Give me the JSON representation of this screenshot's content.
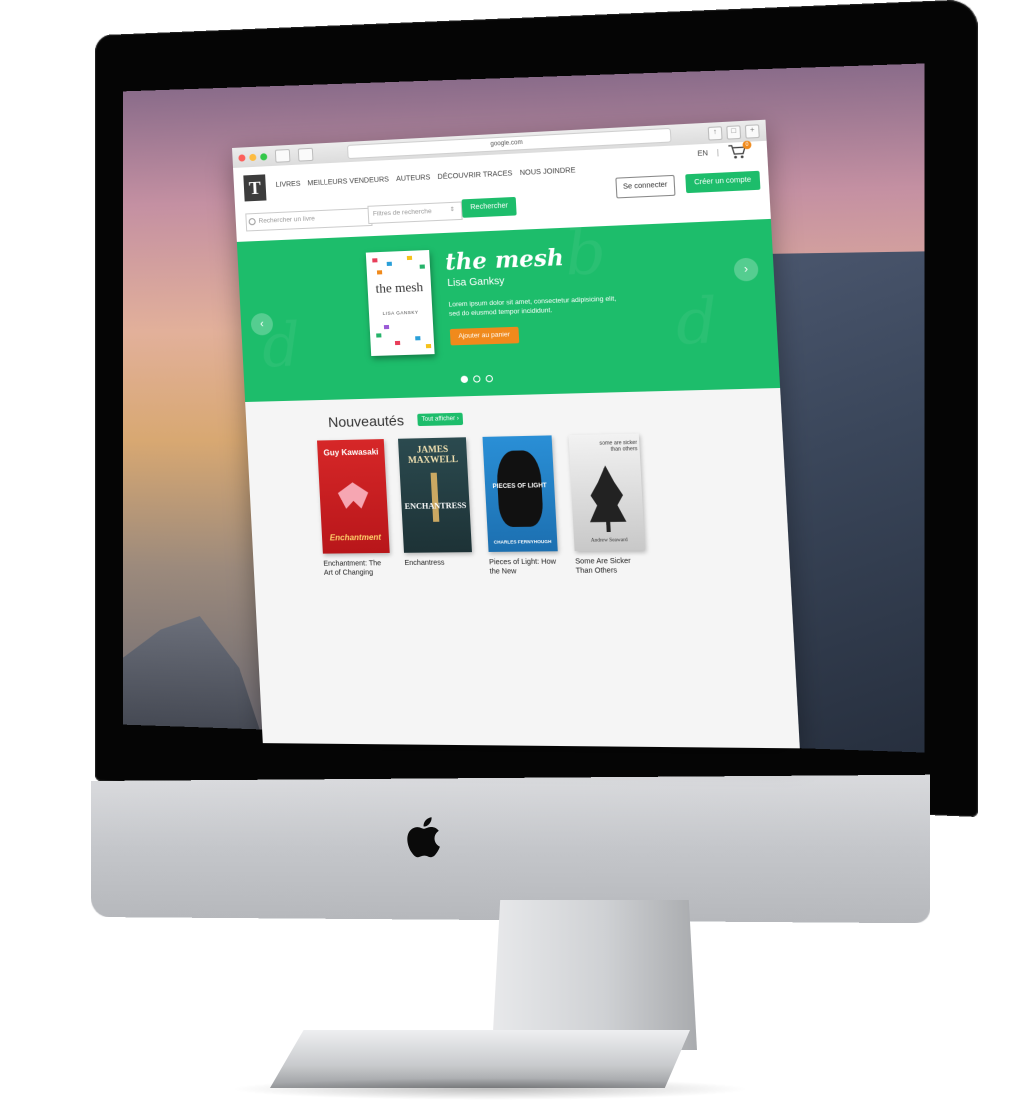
{
  "browser": {
    "address": "google.com"
  },
  "site": {
    "logo": "T",
    "nav": [
      "LIVRES",
      "MEILLEURS VENDEURS",
      "AUTEURS",
      "DÉCOUVRIR TRACES",
      "NOUS JOINDRE"
    ],
    "lang": "EN",
    "lang_sep": "|",
    "cart_count": "0",
    "login_label": "Se connecter",
    "signup_label": "Créer un compte",
    "search_placeholder": "Rechercher un livre",
    "filter_placeholder": "Filtres de recherche",
    "search_label": "Rechercher"
  },
  "hero": {
    "cover_title": "the mesh",
    "cover_author": "LISA GANSKY",
    "title": "the mesh",
    "author": "Lisa Ganksy",
    "description": "Lorem ipsum dolor sit amet, consectetur adipisicing elit, sed do eiusmod tempor incididunt.",
    "add_to_cart_label": "Ajouter au panier",
    "prev_icon": "chevron-left-icon",
    "next_icon": "chevron-right-icon",
    "slides": 3,
    "active_slide": 1
  },
  "new_releases": {
    "title": "Nouveautés",
    "show_all_label": "Tout afficher ›",
    "books": [
      {
        "title": "Enchantment: The Art of Changing",
        "cover_top": "Guy Kawasaki",
        "cover_bottom": "Enchantment"
      },
      {
        "title": "Enchantress",
        "cover_top": "JAMES MAXWELL",
        "cover_bottom": "ENCHANTRESS"
      },
      {
        "title": "Pieces of Light: How the New",
        "cover_top": "PIECES OF LIGHT",
        "cover_bottom": "CHARLES FERNYHOUGH"
      },
      {
        "title": "Some Are Sicker Than Others",
        "cover_top": "some are sicker than others",
        "cover_bottom": "Andrew Seaward"
      }
    ]
  },
  "colors": {
    "brand_green": "#1dbd6b",
    "accent_orange": "#f08a1c"
  }
}
